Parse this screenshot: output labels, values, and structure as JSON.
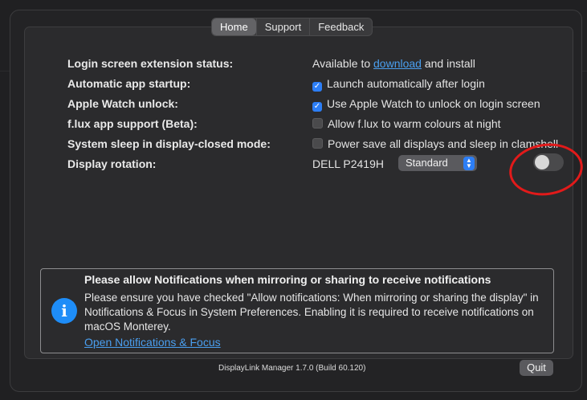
{
  "tabs": [
    "Home",
    "Support",
    "Feedback"
  ],
  "rows": [
    {
      "label": "Login screen extension status:",
      "pre": "Available to ",
      "link": "download",
      "post": " and install"
    },
    {
      "label": "Automatic app startup:",
      "checked": true,
      "text": "Launch automatically after login"
    },
    {
      "label": "Apple Watch unlock:",
      "checked": true,
      "text": "Use Apple Watch to unlock on login screen"
    },
    {
      "label": "f.lux app support (Beta):",
      "checked": false,
      "text": "Allow f.lux to warm colours at night"
    },
    {
      "label": "System sleep in display-closed mode:",
      "checked": false,
      "text": "Power save all displays and sleep in clamshell"
    },
    {
      "label": "Display rotation:",
      "display": "DELL P2419H",
      "select": "Standard",
      "toggle_on": false
    }
  ],
  "notice": {
    "title": "Please allow Notifications when mirroring or sharing to receive notifications",
    "body": "Please ensure you have checked \"Allow notifications: When mirroring or sharing the display\" in Notifications & Focus in System Preferences. Enabling it is required to receive notifications on macOS Monterey.",
    "link": "Open Notifications & Focus"
  },
  "footer": {
    "version": "DisplayLink Manager 1.7.0 (Build 60.120)",
    "quit": "Quit"
  },
  "colors": {
    "accent": "#2c7ef6",
    "link": "#4a9ff0",
    "annotation": "#e21a1a"
  }
}
